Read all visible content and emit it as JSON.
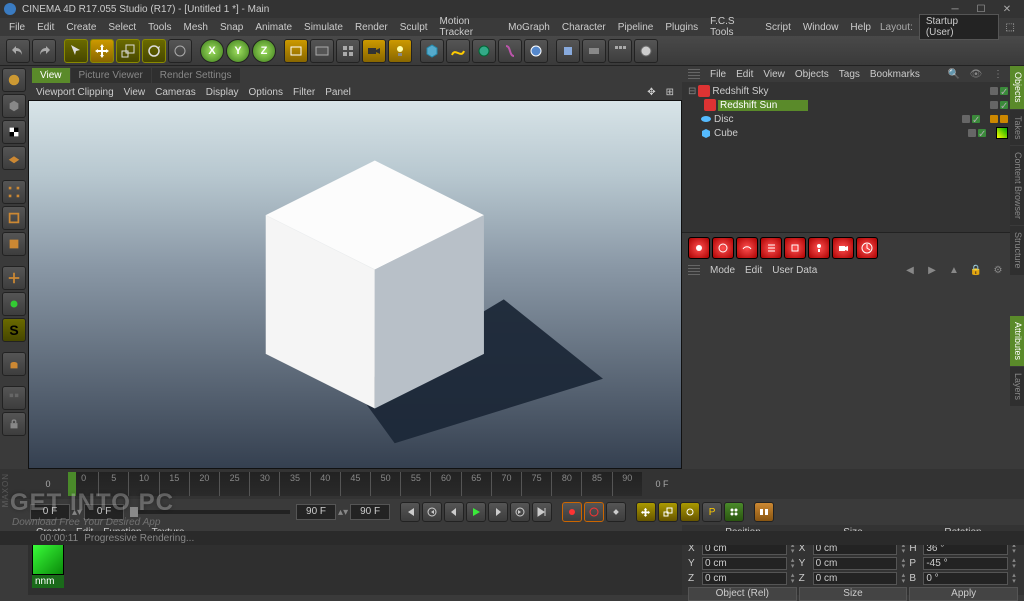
{
  "title": "CINEMA 4D R17.055 Studio (R17) - [Untitled 1 *] - Main",
  "menubar": [
    "File",
    "Edit",
    "Create",
    "Select",
    "Tools",
    "Mesh",
    "Snap",
    "Animate",
    "Simulate",
    "Render",
    "Sculpt",
    "Motion Tracker",
    "MoGraph",
    "Character",
    "Pipeline",
    "Plugins",
    "F.C.S Tools",
    "Script",
    "Window",
    "Help"
  ],
  "layout_label": "Layout:",
  "layout_value": "Startup (User)",
  "axes": [
    "X",
    "Y",
    "Z"
  ],
  "view_tabs": [
    "View",
    "Picture Viewer",
    "Render Settings"
  ],
  "viewport_menu": [
    "Viewport Clipping",
    "View",
    "Cameras",
    "Display",
    "Options",
    "Filter",
    "Panel"
  ],
  "objects_menu": [
    "File",
    "Edit",
    "View",
    "Objects",
    "Tags",
    "Bookmarks"
  ],
  "objects_tree": [
    {
      "name": "Redshift Sky",
      "icon": "sky",
      "sel": false,
      "indent": false
    },
    {
      "name": "Redshift Sun",
      "icon": "sun",
      "sel": true,
      "indent": true
    },
    {
      "name": "Disc",
      "icon": "disc",
      "sel": false,
      "indent": false
    },
    {
      "name": "Cube",
      "icon": "cube",
      "sel": false,
      "indent": false
    }
  ],
  "side_tabs_top": [
    "Objects",
    "Takes",
    "Content Browser",
    "Structure"
  ],
  "side_tabs_bot": [
    "Attributes",
    "Layers"
  ],
  "attr_menu": [
    "Mode",
    "Edit",
    "User Data"
  ],
  "timeline": {
    "start": 0,
    "end": 90,
    "step": 5
  },
  "frame_readout": "0 F",
  "time_fields": {
    "a": "0 F",
    "b": "0 F",
    "c": "90 F",
    "d": "90 F"
  },
  "material_menu": [
    "Create",
    "Edit",
    "Function",
    "Texture"
  ],
  "material_name": "nnm",
  "coords": {
    "headers": [
      "Position",
      "Size",
      "Rotation"
    ],
    "rows": [
      {
        "axis": "X",
        "pos": "0 cm",
        "size": "0 cm",
        "rot": "36 °",
        "rot_label": "H"
      },
      {
        "axis": "Y",
        "pos": "0 cm",
        "size": "0 cm",
        "rot": "-45 °",
        "rot_label": "P"
      },
      {
        "axis": "Z",
        "pos": "0 cm",
        "size": "0 cm",
        "rot": "0 °",
        "rot_label": "B"
      }
    ],
    "mode": "Object (Rel)",
    "size_mode": "Size",
    "apply": "Apply"
  },
  "status": {
    "time": "00:00:11",
    "msg": "Progressive Rendering..."
  },
  "watermark": "GET INTO PC",
  "watermark_sub": "Download Free Your Desired App",
  "maxon": "MAXON"
}
